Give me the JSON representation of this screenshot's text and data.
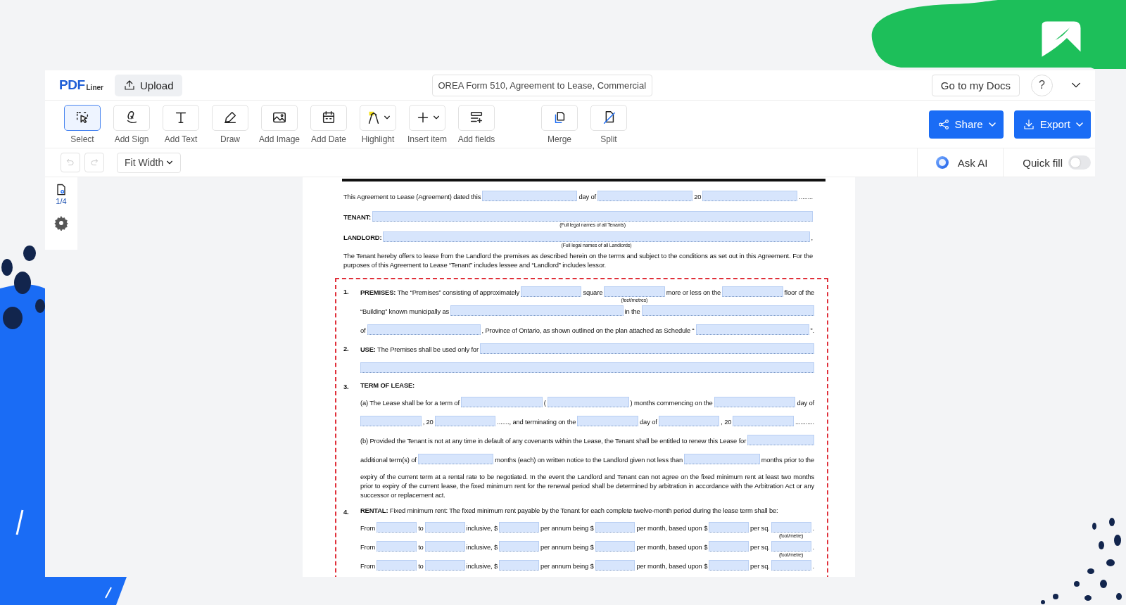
{
  "header": {
    "logo": {
      "main": "PDF",
      "sub": "Liner"
    },
    "upload": "Upload",
    "document_title": "OREA Form 510, Agreement to Lease, Commercial",
    "docs_button": "Go to my Docs",
    "help": "?"
  },
  "tools": [
    {
      "label": "Select",
      "selected": true,
      "dropdown": false
    },
    {
      "label": "Add Sign",
      "selected": false,
      "dropdown": false
    },
    {
      "label": "Add Text",
      "selected": false,
      "dropdown": false
    },
    {
      "label": "Draw",
      "selected": false,
      "dropdown": false
    },
    {
      "label": "Add Image",
      "selected": false,
      "dropdown": false
    },
    {
      "label": "Add Date",
      "selected": false,
      "dropdown": false
    },
    {
      "label": "Highlight",
      "selected": false,
      "dropdown": true
    },
    {
      "label": "Insert item",
      "selected": false,
      "dropdown": true
    },
    {
      "label": "Add fields",
      "selected": false,
      "dropdown": false
    }
  ],
  "page_tools": [
    {
      "label": "Merge",
      "selected": false
    },
    {
      "label": "Split",
      "selected": false
    }
  ],
  "actions": [
    {
      "label": "Share"
    },
    {
      "label": "Export"
    }
  ],
  "view_bar": {
    "undo": {
      "disabled": true
    },
    "redo": {
      "disabled": true
    },
    "zoom": "Fit Width",
    "ask_ai": "Ask AI",
    "quick_fill": {
      "label": "Quick fill",
      "on": false
    }
  },
  "sidebar": {
    "page_counter": "1/4"
  },
  "document": {
    "intro": [
      {
        "kind": "row",
        "parts": [
          {
            "kind": "text",
            "text": "This Agreement to Lease (Agreement) dated this"
          },
          {
            "kind": "field"
          },
          {
            "kind": "text",
            "text": "day of"
          },
          {
            "kind": "field"
          },
          {
            "kind": "text",
            "text": "20"
          },
          {
            "kind": "field"
          },
          {
            "kind": "text",
            "text": "........"
          }
        ]
      },
      {
        "kind": "row",
        "parts": [
          {
            "kind": "text",
            "text": "TENANT:",
            "bold": true
          },
          {
            "kind": "field",
            "caption": "(Full legal names of all Tenants)"
          }
        ]
      },
      {
        "kind": "row",
        "parts": [
          {
            "kind": "text",
            "text": "LANDLORD:",
            "bold": true
          },
          {
            "kind": "field",
            "caption": "(Full legal names of all Landlords)"
          },
          {
            "kind": "text",
            "text": ","
          }
        ]
      },
      {
        "kind": "para",
        "text": "The Tenant hereby offers to lease from the Landlord the premises as described herein on the terms and subject to the conditions as set out in this Agreement. For the purposes of this Agreement to Lease “Tenant” includes lessee and “Landlord” includes lessor."
      }
    ],
    "sections": [
      {
        "number": "1.",
        "rows": [
          {
            "kind": "row",
            "parts": [
              {
                "kind": "text",
                "text": "**PREMISES:** The “Premises” consisting of approximately"
              },
              {
                "kind": "field"
              },
              {
                "kind": "text",
                "text": "square"
              },
              {
                "kind": "field",
                "caption": "(feet/metres)"
              },
              {
                "kind": "text",
                "text": "more or less on the"
              },
              {
                "kind": "field"
              },
              {
                "kind": "text",
                "text": "floor of the"
              }
            ]
          },
          {
            "kind": "row",
            "parts": [
              {
                "kind": "text",
                "text": "“Building” known municipally as"
              },
              {
                "kind": "field"
              },
              {
                "kind": "text",
                "text": "in the"
              },
              {
                "kind": "field"
              }
            ]
          },
          {
            "kind": "row",
            "parts": [
              {
                "kind": "text",
                "text": "of"
              },
              {
                "kind": "field"
              },
              {
                "kind": "text",
                "text": ", Province of Ontario, as shown outlined on the plan attached as Schedule “"
              },
              {
                "kind": "field"
              },
              {
                "kind": "text",
                "text": "”."
              }
            ]
          }
        ]
      },
      {
        "number": "2.",
        "rows": [
          {
            "kind": "row",
            "parts": [
              {
                "kind": "text",
                "text": "**USE:** The Premises shall be used only for"
              },
              {
                "kind": "field"
              }
            ]
          },
          {
            "kind": "row",
            "parts": [
              {
                "kind": "field"
              }
            ]
          }
        ]
      },
      {
        "number": "3.",
        "rows": [
          {
            "kind": "para",
            "text": "TERM OF LEASE:",
            "bold": true
          },
          {
            "kind": "row",
            "parts": [
              {
                "kind": "text",
                "text": "(a) The Lease shall be for a term of"
              },
              {
                "kind": "field"
              },
              {
                "kind": "text",
                "text": "("
              },
              {
                "kind": "field"
              },
              {
                "kind": "text",
                "text": ") months commencing on the"
              },
              {
                "kind": "field"
              },
              {
                "kind": "text",
                "text": "day of"
              }
            ]
          },
          {
            "kind": "row",
            "parts": [
              {
                "kind": "field"
              },
              {
                "kind": "text",
                "text": ", 20"
              },
              {
                "kind": "field"
              },
              {
                "kind": "text",
                "text": "......., and terminating on the"
              },
              {
                "kind": "field"
              },
              {
                "kind": "text",
                "text": "day of"
              },
              {
                "kind": "field"
              },
              {
                "kind": "text",
                "text": ", 20"
              },
              {
                "kind": "field"
              },
              {
                "kind": "text",
                "text": "..........."
              }
            ]
          },
          {
            "kind": "row",
            "parts": [
              {
                "kind": "text",
                "text": "(b) Provided the Tenant is not at any time in default of any covenants within the Lease, the Tenant shall be entitled to renew this Lease for"
              },
              {
                "kind": "field"
              }
            ]
          },
          {
            "kind": "row",
            "parts": [
              {
                "kind": "text",
                "text": "additional term(s) of"
              },
              {
                "kind": "field"
              },
              {
                "kind": "text",
                "text": "months (each) on written notice to the Landlord given not less than"
              },
              {
                "kind": "field"
              },
              {
                "kind": "text",
                "text": "months prior to the"
              }
            ]
          },
          {
            "kind": "para",
            "text": "expiry of the current term at a rental rate to be negotiated. In the event the Landlord and Tenant can not agree on the fixed minimum rent at least two months prior to expiry of the current lease, the fixed minimum rent for the renewal period shall be determined by arbitration in accordance with the Arbitration Act or any successor or replacement act."
          }
        ]
      },
      {
        "number": "4.",
        "rows": [
          {
            "kind": "para",
            "text": "**RENTAL:** Fixed minimum rent: The fixed minimum rent payable by the Tenant for each complete twelve-month period during the lease term shall be:"
          },
          {
            "kind": "row",
            "parts": [
              {
                "kind": "text",
                "text": "From"
              },
              {
                "kind": "field"
              },
              {
                "kind": "text",
                "text": "to"
              },
              {
                "kind": "field"
              },
              {
                "kind": "text",
                "text": "inclusive, $"
              },
              {
                "kind": "field"
              },
              {
                "kind": "text",
                "text": "per annum being $"
              },
              {
                "kind": "field"
              },
              {
                "kind": "text",
                "text": "per month, based upon $"
              },
              {
                "kind": "field"
              },
              {
                "kind": "text",
                "text": "per sq."
              },
              {
                "kind": "field",
                "caption": "(foot/metre)"
              },
              {
                "kind": "text",
                "text": "."
              }
            ]
          },
          {
            "kind": "row",
            "parts": [
              {
                "kind": "text",
                "text": "From"
              },
              {
                "kind": "field"
              },
              {
                "kind": "text",
                "text": "to"
              },
              {
                "kind": "field"
              },
              {
                "kind": "text",
                "text": "inclusive, $"
              },
              {
                "kind": "field"
              },
              {
                "kind": "text",
                "text": "per annum being $"
              },
              {
                "kind": "field"
              },
              {
                "kind": "text",
                "text": "per month, based upon $"
              },
              {
                "kind": "field"
              },
              {
                "kind": "text",
                "text": "per sq."
              },
              {
                "kind": "field",
                "caption": "(foot/metre)"
              },
              {
                "kind": "text",
                "text": "."
              }
            ]
          },
          {
            "kind": "row",
            "parts": [
              {
                "kind": "text",
                "text": "From"
              },
              {
                "kind": "field"
              },
              {
                "kind": "text",
                "text": "to"
              },
              {
                "kind": "field"
              },
              {
                "kind": "text",
                "text": "inclusive, $"
              },
              {
                "kind": "field"
              },
              {
                "kind": "text",
                "text": "per annum being $"
              },
              {
                "kind": "field"
              },
              {
                "kind": "text",
                "text": "per month, based upon $"
              },
              {
                "kind": "field"
              },
              {
                "kind": "text",
                "text": "per sq."
              },
              {
                "kind": "field"
              },
              {
                "kind": "text",
                "text": "."
              }
            ]
          }
        ]
      }
    ]
  }
}
